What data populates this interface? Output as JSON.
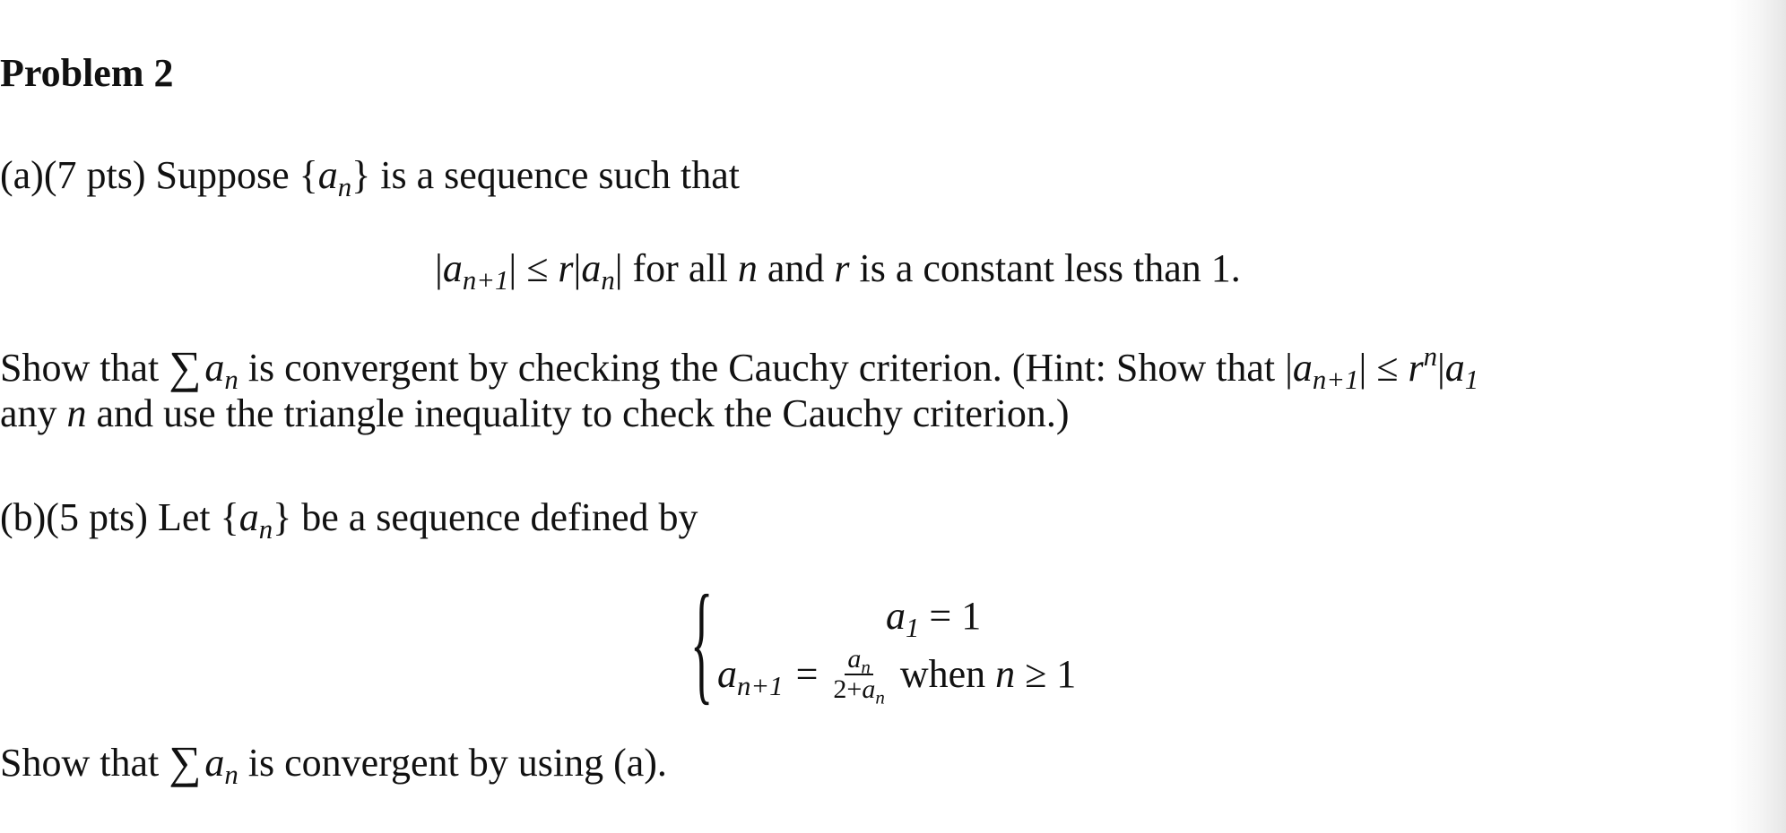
{
  "title": "Problem 2",
  "part_a": {
    "label": "(a)(7 pts) Suppose ",
    "set_open": "{",
    "var": "a",
    "sub_n": "n",
    "set_close": "}",
    "rest": " is a sequence such that",
    "condition": {
      "lhs_var": "a",
      "lhs_sub": "n+1",
      "leq": "≤",
      "r": "r",
      "rhs_var": "a",
      "rhs_sub": "n",
      "text1": " for all ",
      "n": "n",
      "text2": " and ",
      "r2": "r",
      "text3": " is a constant less than 1."
    },
    "task_prefix": "Show that ",
    "sum": "∑",
    "task_mid": " is convergent by checking the Cauchy criterion. (Hint: Show that ",
    "hint_exp": "n",
    "hint_sub1": "1",
    "task_line2_prefix": "any ",
    "task_line2_rest": " and use the triangle inequality to check the Cauchy criterion.)"
  },
  "part_b": {
    "label": "(b)(5 pts) Let ",
    "rest": " be a sequence defined by",
    "case1": {
      "var": "a",
      "sub": "1",
      "eq": " = 1"
    },
    "case2": {
      "var": "a",
      "sub": "n+1",
      "eq": "=",
      "frac_num_var": "a",
      "frac_num_sub": "n",
      "frac_den_prefix": "2+",
      "frac_den_var": "a",
      "frac_den_sub": "n",
      "when": "when ",
      "n": "n",
      "cond": " ≥ 1"
    },
    "task_prefix": "Show that ",
    "task_rest": " is convergent by using (a)."
  }
}
